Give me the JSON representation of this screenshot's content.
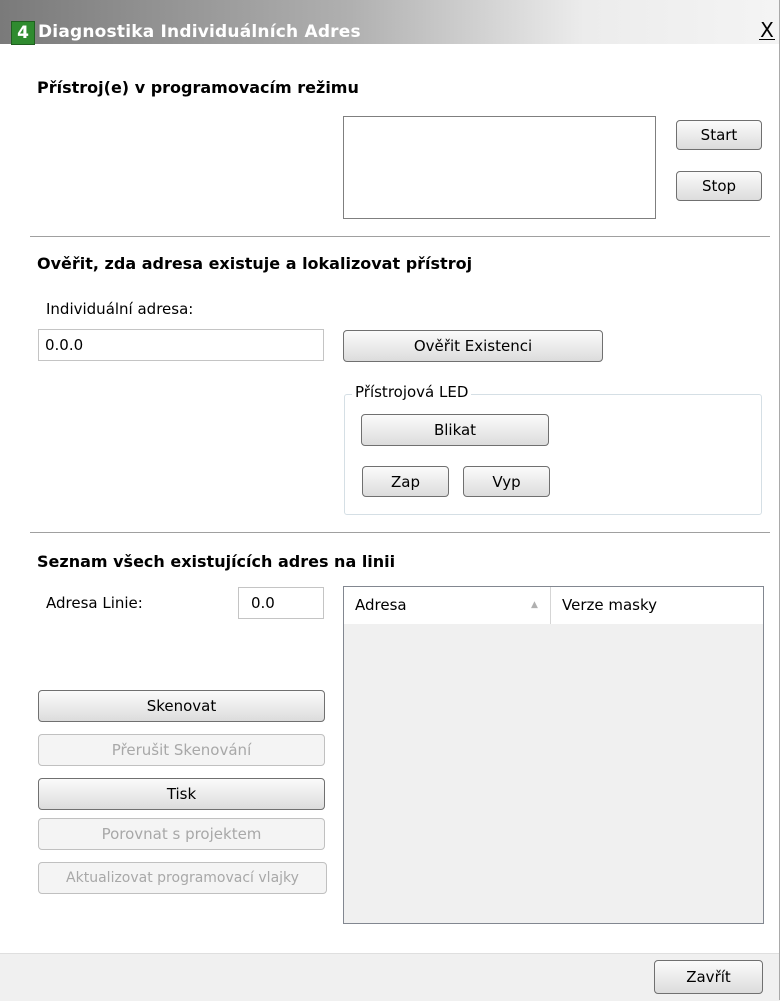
{
  "window": {
    "title": "Diagnostika Individuálních Adres",
    "icon_text": "4",
    "close_label": "X"
  },
  "programming_mode": {
    "title": "Přístroj(e) v programovacím režimu",
    "start_label": "Start",
    "stop_label": "Stop"
  },
  "verify": {
    "title": "Ověřit, zda adresa existuje a lokalizovat přístroj",
    "address_label": "Individuální adresa:",
    "address_value": "0.0.0",
    "verify_button": "Ověřit Existenci",
    "led_group": {
      "legend": "Přístrojová LED",
      "blink_button": "Blikat",
      "on_button": "Zap",
      "off_button": "Vyp"
    }
  },
  "scan": {
    "title": "Seznam všech existujících adres na linii",
    "line_label": "Adresa Linie:",
    "line_value": "0.0",
    "buttons": {
      "scan": "Skenovat",
      "stop_scan": "Přerušit Skenování",
      "print": "Tisk",
      "compare": "Porovnat s projektem",
      "update_flags": "Aktualizovat programovací vlajky"
    },
    "table": {
      "columns": [
        "Adresa",
        "Verze masky"
      ],
      "sort_icon": "sort-ascending-icon",
      "rows": []
    }
  },
  "footer": {
    "close_button": "Zavřít"
  },
  "colors": {
    "icon_green": "#2f8b2f",
    "disabled_text": "#a8a8a8"
  }
}
